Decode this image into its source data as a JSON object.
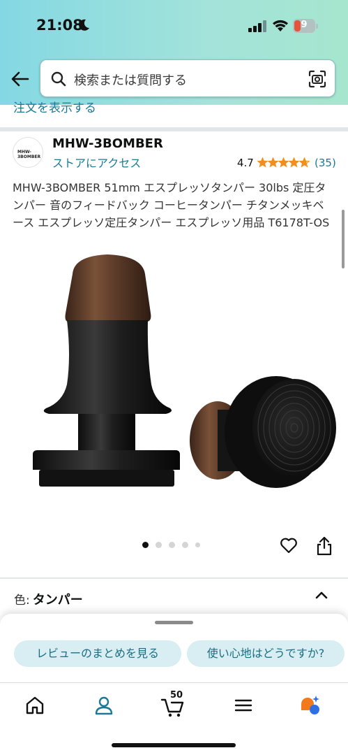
{
  "status_bar": {
    "time": "21:08",
    "battery_level": "9"
  },
  "search": {
    "placeholder": "検索または質問する"
  },
  "peek_link": "注文を表示する",
  "brand": {
    "logo_text": "MHW-3BOMBER",
    "name": "MHW-3BOMBER",
    "store_link": "ストアにアクセス",
    "rating": "4.7",
    "rating_stars": 4.7,
    "review_count": "(35)"
  },
  "product": {
    "title": "MHW-3BOMBER 51mm エスプレッソタンパー 30lbs 定圧タンパー 音のフィードバック コーヒータンパー チタンメッキベース エスプレッソ定圧タンパー エスプレッソ用品 T6178T-OS",
    "image_count": 5,
    "active_image": 1
  },
  "variation": {
    "label": "色:",
    "value": "タンパー"
  },
  "sheet": {
    "chips": [
      "レビューのまとめを見る",
      "使い心地はどうですか?"
    ]
  },
  "nav": {
    "cart_count": "50"
  },
  "colors": {
    "accent_link": "#1a7a96",
    "chip_bg": "#d8eef3",
    "star": "#f08f1e"
  }
}
